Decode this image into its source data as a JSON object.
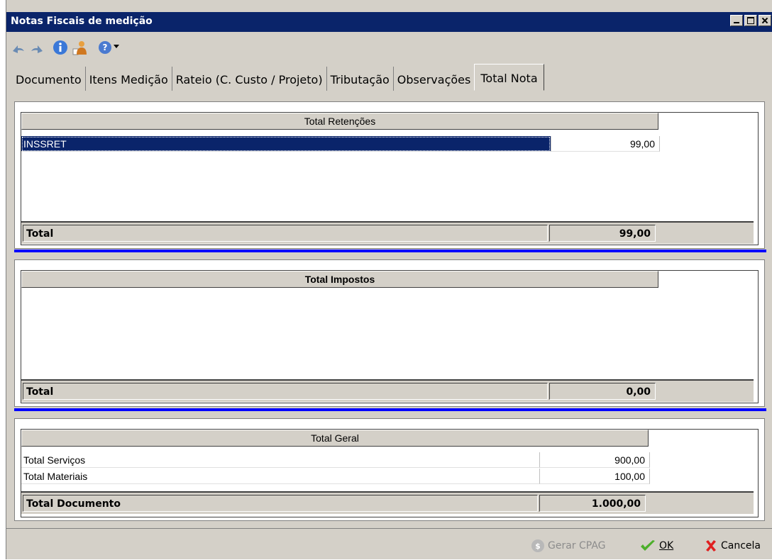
{
  "window": {
    "title": "Notas Fiscais de medição"
  },
  "tabs": [
    {
      "label": "Documento",
      "active": false
    },
    {
      "label": "Itens Medição",
      "active": false
    },
    {
      "label": "Rateio (C. Custo / Projeto)",
      "active": false
    },
    {
      "label": "Tributação",
      "active": false
    },
    {
      "label": "Observações",
      "active": false
    },
    {
      "label": "Total Nota",
      "active": true
    }
  ],
  "retencoes": {
    "header": "Total Retenções",
    "rows": [
      {
        "name": "INSSRET",
        "value": "99,00"
      }
    ],
    "total_label": "Total",
    "total_value": "99,00"
  },
  "impostos": {
    "header": "Total Impostos",
    "total_label": "Total",
    "total_value": "0,00"
  },
  "geral": {
    "header": "Total Geral",
    "rows": [
      {
        "name": "Total Serviços",
        "value": "900,00"
      },
      {
        "name": "Total Materiais",
        "value": "100,00"
      }
    ],
    "total_label": "Total Documento",
    "total_value": "1.000,00"
  },
  "footer": {
    "gerar_label": "Gerar CPAG",
    "ok_label": "OK",
    "cancel_label": "Cancela"
  },
  "colors": {
    "titlebar": "#0a246a",
    "selection": "#0a246a",
    "separator": "#0000ff"
  }
}
